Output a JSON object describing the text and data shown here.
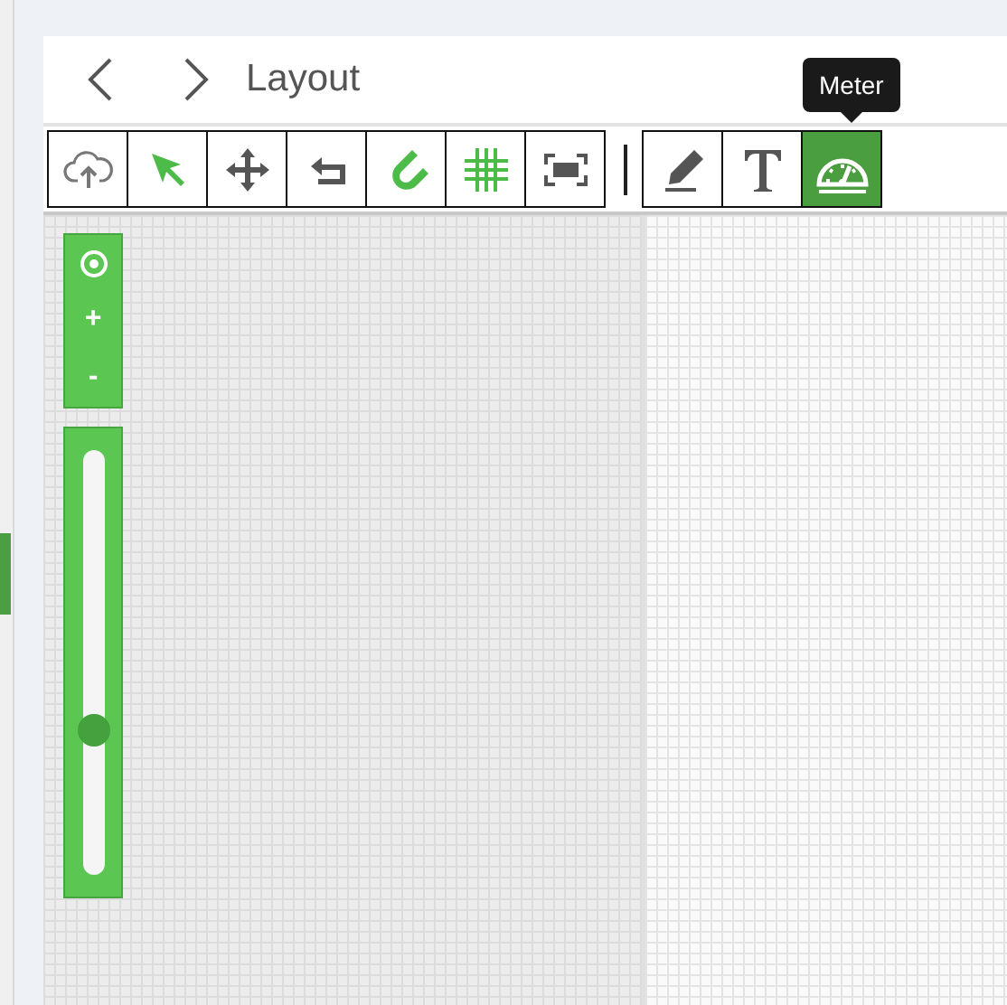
{
  "header": {
    "title": "Layout"
  },
  "tool_groups": [
    {
      "tools": [
        {
          "kind": "upload",
          "selected": false
        },
        {
          "kind": "pointer",
          "selected": false
        },
        {
          "kind": "move",
          "selected": false
        },
        {
          "kind": "undo",
          "selected": false
        },
        {
          "kind": "magnet",
          "selected": false
        },
        {
          "kind": "grid",
          "selected": false
        },
        {
          "kind": "fit",
          "selected": false
        }
      ]
    },
    {
      "tools": [
        {
          "kind": "pencil",
          "selected": false
        },
        {
          "kind": "text",
          "selected": false
        },
        {
          "kind": "meter",
          "selected": true
        }
      ]
    }
  ],
  "tooltip": "Meter",
  "zoom_controls": [
    "+",
    "-"
  ],
  "zoom_slider": {
    "level": 0.34
  }
}
